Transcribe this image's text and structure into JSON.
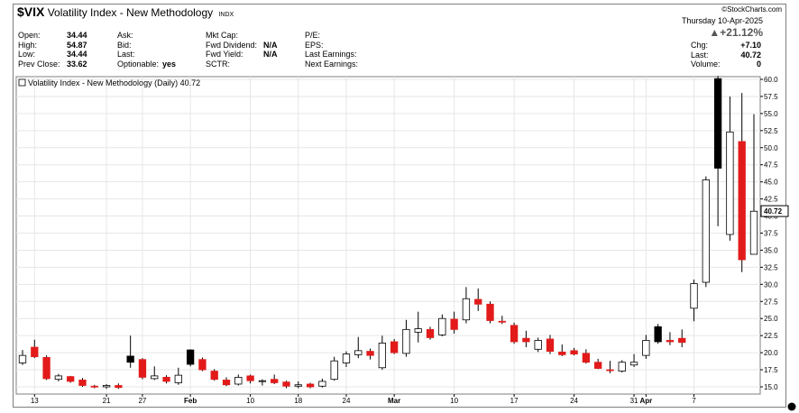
{
  "header": {
    "symbol": "$VIX",
    "name": "Volatility Index - New Methodology",
    "exchange": "INDX",
    "source": "©StockCharts.com",
    "date": "Thursday 10-Apr-2025",
    "change_pct": "▲+21.12%"
  },
  "info": {
    "col1": [
      {
        "label": "Open:",
        "value": "34.44"
      },
      {
        "label": "High:",
        "value": "54.87"
      },
      {
        "label": "Low:",
        "value": "34.44"
      },
      {
        "label": "Prev Close:",
        "value": "33.62"
      }
    ],
    "col2": [
      {
        "label": "Ask:",
        "value": ""
      },
      {
        "label": "Bid:",
        "value": ""
      },
      {
        "label": "Last:",
        "value": ""
      },
      {
        "label": "Optionable:",
        "value": "yes"
      }
    ],
    "col3": [
      {
        "label": "Mkt Cap:",
        "value": ""
      },
      {
        "label": "Fwd Dividend:",
        "value": "N/A"
      },
      {
        "label": "Fwd Yield:",
        "value": "N/A"
      },
      {
        "label": "SCTR:",
        "value": ""
      }
    ],
    "col4": [
      {
        "label": "P/E:",
        "value": ""
      },
      {
        "label": "EPS:",
        "value": ""
      },
      {
        "label": "Last Earnings:",
        "value": ""
      },
      {
        "label": "Next Earnings:",
        "value": ""
      }
    ],
    "col5": [
      {
        "label": "Chg:",
        "value": "+7.10"
      },
      {
        "label": "Last:",
        "value": "40.72"
      },
      {
        "label": "Volume:",
        "value": "0"
      }
    ]
  },
  "chart_data": {
    "type": "candlestick",
    "legend": "Volatility Index - New Methodology (Daily) 40.72",
    "last_value_label": "40.72",
    "ylim": [
      14.0,
      61.0
    ],
    "y_ticks": [
      "15.0",
      "17.5",
      "20.0",
      "22.5",
      "25.0",
      "27.5",
      "30.0",
      "32.5",
      "35.0",
      "37.5",
      "40.0",
      "42.5",
      "45.0",
      "47.5",
      "50.0",
      "52.5",
      "55.0",
      "57.5",
      "60.0"
    ],
    "x_ticks": [
      {
        "index": 1,
        "label": "13"
      },
      {
        "index": 7,
        "label": "21"
      },
      {
        "index": 10,
        "label": "27"
      },
      {
        "index": 14,
        "label": "Feb"
      },
      {
        "index": 19,
        "label": "10"
      },
      {
        "index": 23,
        "label": "18"
      },
      {
        "index": 27,
        "label": "24"
      },
      {
        "index": 31,
        "label": "Mar"
      },
      {
        "index": 36,
        "label": "10"
      },
      {
        "index": 41,
        "label": "17"
      },
      {
        "index": 46,
        "label": "24"
      },
      {
        "index": 51,
        "label": "31"
      },
      {
        "index": 52,
        "label": "Apr"
      },
      {
        "index": 56,
        "label": "7"
      }
    ],
    "colors": {
      "up": "#ffffff",
      "down_red": "#e31a1a",
      "down_black": "#000000",
      "wick": "#000000"
    },
    "candles": [
      {
        "o": 18.5,
        "h": 20.4,
        "l": 18.2,
        "c": 19.6,
        "k": "up"
      },
      {
        "o": 20.8,
        "h": 21.9,
        "l": 19.2,
        "c": 19.4,
        "k": "red"
      },
      {
        "o": 19.3,
        "h": 19.6,
        "l": 16.0,
        "c": 16.2,
        "k": "red"
      },
      {
        "o": 16.1,
        "h": 16.9,
        "l": 15.8,
        "c": 16.6,
        "k": "up"
      },
      {
        "o": 16.5,
        "h": 16.6,
        "l": 15.6,
        "c": 15.8,
        "k": "red"
      },
      {
        "o": 16.0,
        "h": 16.3,
        "l": 15.0,
        "c": 15.2,
        "k": "red"
      },
      {
        "o": 15.1,
        "h": 15.3,
        "l": 14.8,
        "c": 15.0,
        "k": "red"
      },
      {
        "o": 15.0,
        "h": 15.4,
        "l": 14.7,
        "c": 15.2,
        "k": "up"
      },
      {
        "o": 15.2,
        "h": 15.5,
        "l": 14.7,
        "c": 14.9,
        "k": "red"
      },
      {
        "o": 18.6,
        "h": 22.5,
        "l": 17.8,
        "c": 19.5,
        "k": "black"
      },
      {
        "o": 19.0,
        "h": 19.2,
        "l": 16.1,
        "c": 16.4,
        "k": "red"
      },
      {
        "o": 16.2,
        "h": 18.0,
        "l": 16.0,
        "c": 16.6,
        "k": "up"
      },
      {
        "o": 16.4,
        "h": 16.7,
        "l": 15.5,
        "c": 15.8,
        "k": "red"
      },
      {
        "o": 15.6,
        "h": 17.8,
        "l": 15.3,
        "c": 16.7,
        "k": "up"
      },
      {
        "o": 18.3,
        "h": 20.5,
        "l": 18.0,
        "c": 20.4,
        "k": "black"
      },
      {
        "o": 19.0,
        "h": 19.3,
        "l": 17.3,
        "c": 17.5,
        "k": "red"
      },
      {
        "o": 17.3,
        "h": 17.6,
        "l": 15.9,
        "c": 16.1,
        "k": "red"
      },
      {
        "o": 16.0,
        "h": 16.4,
        "l": 15.1,
        "c": 15.3,
        "k": "red"
      },
      {
        "o": 15.4,
        "h": 16.8,
        "l": 15.2,
        "c": 16.4,
        "k": "up"
      },
      {
        "o": 16.6,
        "h": 16.8,
        "l": 15.5,
        "c": 15.9,
        "k": "red"
      },
      {
        "o": 15.8,
        "h": 16.1,
        "l": 15.2,
        "c": 15.9,
        "k": "up"
      },
      {
        "o": 16.1,
        "h": 16.8,
        "l": 15.4,
        "c": 15.6,
        "k": "red"
      },
      {
        "o": 15.7,
        "h": 15.9,
        "l": 14.8,
        "c": 15.1,
        "k": "red"
      },
      {
        "o": 15.1,
        "h": 15.8,
        "l": 14.8,
        "c": 15.3,
        "k": "up"
      },
      {
        "o": 15.4,
        "h": 15.6,
        "l": 14.8,
        "c": 15.0,
        "k": "red"
      },
      {
        "o": 15.1,
        "h": 16.2,
        "l": 14.9,
        "c": 15.8,
        "k": "up"
      },
      {
        "o": 16.1,
        "h": 19.4,
        "l": 15.9,
        "c": 18.8,
        "k": "up"
      },
      {
        "o": 18.5,
        "h": 20.2,
        "l": 17.9,
        "c": 19.8,
        "k": "up"
      },
      {
        "o": 19.7,
        "h": 22.3,
        "l": 19.2,
        "c": 20.3,
        "k": "up"
      },
      {
        "o": 20.2,
        "h": 20.6,
        "l": 19.0,
        "c": 19.6,
        "k": "red"
      },
      {
        "o": 17.8,
        "h": 22.5,
        "l": 17.5,
        "c": 21.4,
        "k": "up"
      },
      {
        "o": 21.6,
        "h": 22.0,
        "l": 19.8,
        "c": 20.0,
        "k": "red"
      },
      {
        "o": 19.9,
        "h": 24.8,
        "l": 19.4,
        "c": 23.4,
        "k": "up"
      },
      {
        "o": 23.0,
        "h": 26.0,
        "l": 21.5,
        "c": 23.5,
        "k": "up"
      },
      {
        "o": 23.4,
        "h": 23.8,
        "l": 21.9,
        "c": 22.2,
        "k": "red"
      },
      {
        "o": 22.6,
        "h": 25.6,
        "l": 22.4,
        "c": 25.0,
        "k": "up"
      },
      {
        "o": 24.9,
        "h": 26.0,
        "l": 22.8,
        "c": 23.4,
        "k": "red"
      },
      {
        "o": 24.8,
        "h": 29.6,
        "l": 24.3,
        "c": 27.9,
        "k": "up"
      },
      {
        "o": 27.8,
        "h": 29.4,
        "l": 26.1,
        "c": 27.1,
        "k": "red"
      },
      {
        "o": 27.1,
        "h": 27.5,
        "l": 24.3,
        "c": 24.7,
        "k": "red"
      },
      {
        "o": 24.6,
        "h": 25.4,
        "l": 24.2,
        "c": 24.6,
        "k": "red"
      },
      {
        "o": 24.0,
        "h": 24.4,
        "l": 21.3,
        "c": 21.6,
        "k": "red"
      },
      {
        "o": 21.6,
        "h": 23.2,
        "l": 20.8,
        "c": 22.1,
        "k": "red"
      },
      {
        "o": 20.5,
        "h": 22.2,
        "l": 20.1,
        "c": 21.8,
        "k": "up"
      },
      {
        "o": 22.0,
        "h": 22.6,
        "l": 19.8,
        "c": 20.2,
        "k": "red"
      },
      {
        "o": 20.1,
        "h": 21.2,
        "l": 19.5,
        "c": 19.7,
        "k": "red"
      },
      {
        "o": 20.3,
        "h": 20.7,
        "l": 19.6,
        "c": 19.8,
        "k": "red"
      },
      {
        "o": 19.9,
        "h": 20.5,
        "l": 18.4,
        "c": 18.6,
        "k": "red"
      },
      {
        "o": 18.6,
        "h": 19.1,
        "l": 17.6,
        "c": 17.7,
        "k": "red"
      },
      {
        "o": 17.4,
        "h": 18.8,
        "l": 17.0,
        "c": 17.5,
        "k": "red"
      },
      {
        "o": 17.3,
        "h": 18.9,
        "l": 17.1,
        "c": 18.6,
        "k": "up"
      },
      {
        "o": 18.2,
        "h": 19.8,
        "l": 17.9,
        "c": 18.6,
        "k": "up"
      },
      {
        "o": 19.6,
        "h": 22.6,
        "l": 19.1,
        "c": 21.8,
        "k": "up"
      },
      {
        "o": 21.6,
        "h": 24.2,
        "l": 21.3,
        "c": 23.8,
        "k": "black"
      },
      {
        "o": 21.8,
        "h": 23.0,
        "l": 21.1,
        "c": 21.6,
        "k": "red"
      },
      {
        "o": 22.1,
        "h": 23.4,
        "l": 20.8,
        "c": 21.5,
        "k": "red"
      },
      {
        "o": 26.5,
        "h": 30.7,
        "l": 24.6,
        "c": 30.1,
        "k": "up"
      },
      {
        "o": 30.3,
        "h": 45.8,
        "l": 29.6,
        "c": 45.3,
        "k": "up"
      },
      {
        "o": 60.1,
        "h": 60.5,
        "l": 38.5,
        "c": 47.0,
        "k": "black"
      },
      {
        "o": 37.3,
        "h": 57.5,
        "l": 36.4,
        "c": 52.3,
        "k": "up"
      },
      {
        "o": 50.9,
        "h": 58.0,
        "l": 31.8,
        "c": 33.6,
        "k": "red"
      },
      {
        "o": 34.4,
        "h": 54.9,
        "l": 34.4,
        "c": 40.7,
        "k": "up"
      }
    ]
  }
}
